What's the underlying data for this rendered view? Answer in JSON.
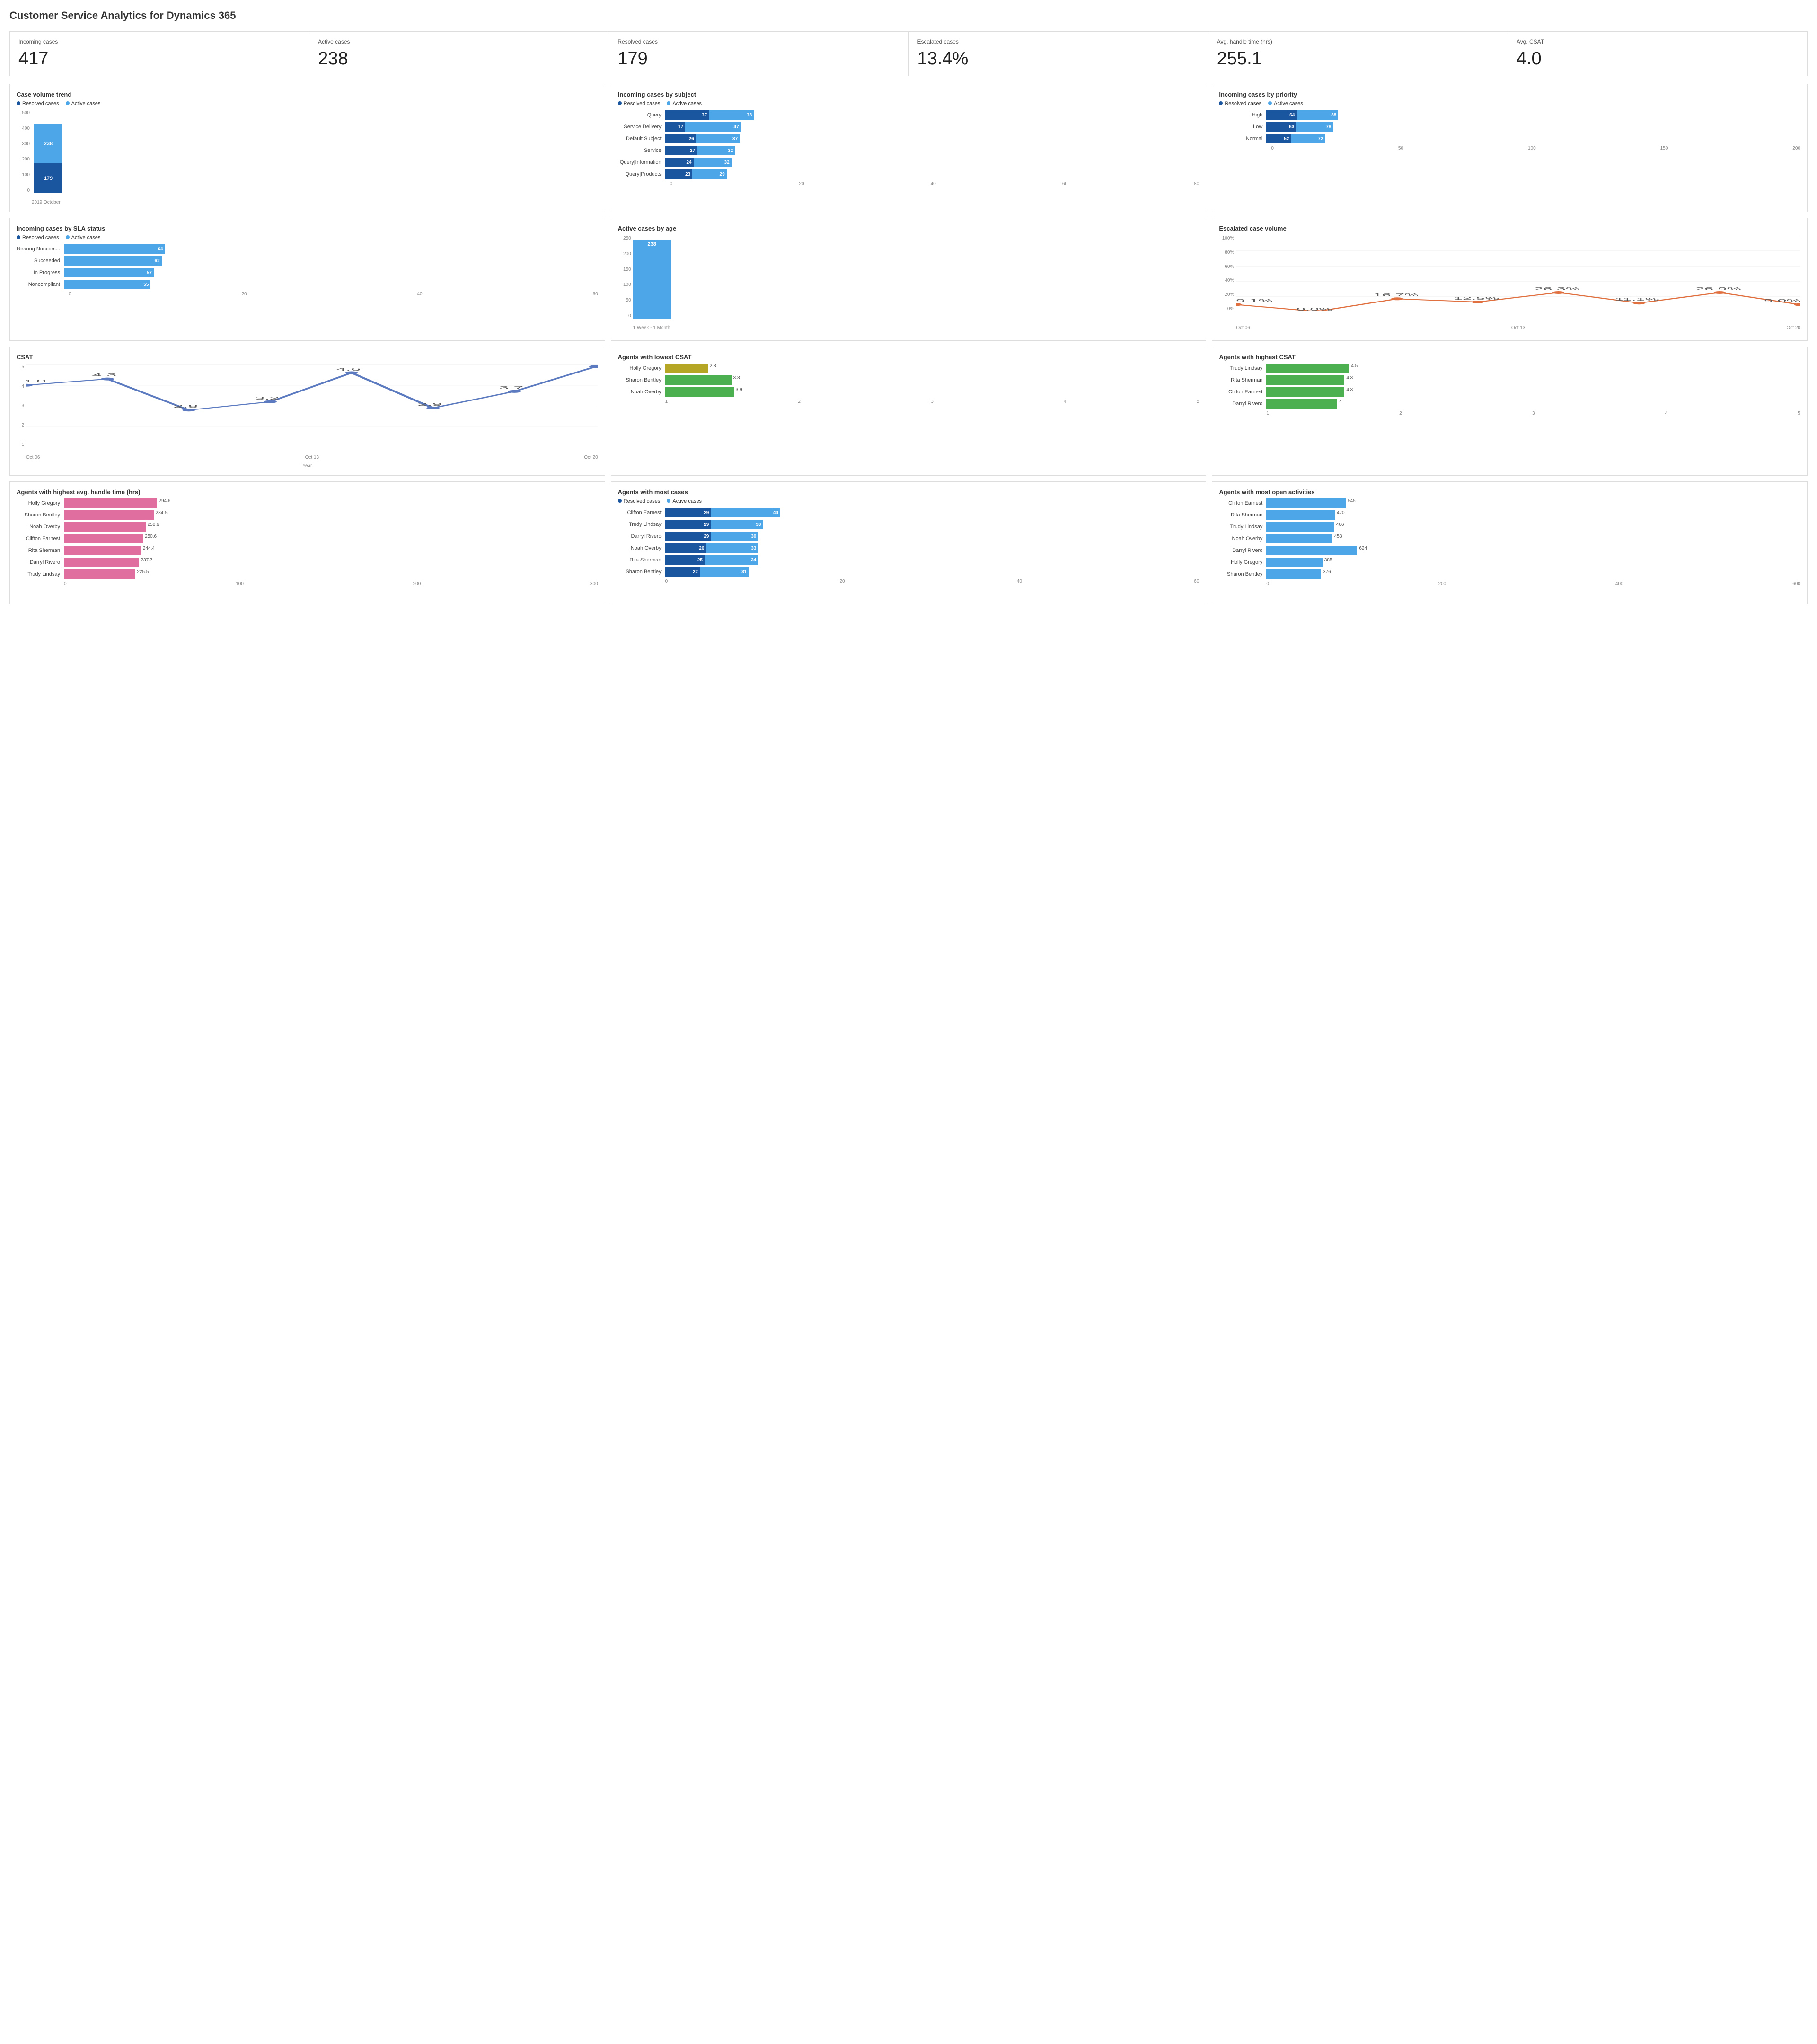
{
  "title": "Customer Service Analytics for Dynamics 365",
  "kpis": [
    {
      "label": "Incoming cases",
      "value": "417"
    },
    {
      "label": "Active cases",
      "value": "238"
    },
    {
      "label": "Resolved cases",
      "value": "179"
    },
    {
      "label": "Escalated cases",
      "value": "13.4%"
    },
    {
      "label": "Avg. handle time (hrs)",
      "value": "255.1"
    },
    {
      "label": "Avg. CSAT",
      "value": "4.0"
    }
  ],
  "caseVolumeTrend": {
    "title": "Case volume trend",
    "legend": [
      "Resolved cases",
      "Active cases"
    ],
    "yLabels": [
      "500",
      "400",
      "300",
      "200",
      "100",
      "0"
    ],
    "bar": {
      "label": "2019 October",
      "resolved": 179,
      "active": 238,
      "totalHeight": 320
    }
  },
  "incomingBySubject": {
    "title": "Incoming cases by subject",
    "legend": [
      "Resolved cases",
      "Active cases"
    ],
    "maxVal": 80,
    "xTicks": [
      "0",
      "20",
      "40",
      "60",
      "80"
    ],
    "rows": [
      {
        "label": "Query",
        "resolved": 37,
        "active": 38
      },
      {
        "label": "Service|Delivery",
        "resolved": 17,
        "active": 47
      },
      {
        "label": "Default Subject",
        "resolved": 26,
        "active": 37
      },
      {
        "label": "Service",
        "resolved": 27,
        "active": 32
      },
      {
        "label": "Query|Information",
        "resolved": 24,
        "active": 32
      },
      {
        "label": "Query|Products",
        "resolved": 23,
        "active": 29
      }
    ]
  },
  "incomingByPriority": {
    "title": "Incoming cases by priority",
    "legend": [
      "Resolved cases",
      "Active cases"
    ],
    "maxVal": 200,
    "xTicks": [
      "0",
      "50",
      "100",
      "150",
      "200"
    ],
    "rows": [
      {
        "label": "High",
        "resolved": 64,
        "active": 88
      },
      {
        "label": "Low",
        "resolved": 63,
        "active": 78
      },
      {
        "label": "Normal",
        "resolved": 52,
        "active": 72
      }
    ]
  },
  "bySLA": {
    "title": "Incoming cases by SLA status",
    "legend": [
      "Resolved cases",
      "Active cases"
    ],
    "maxVal": 60,
    "xTicks": [
      "0",
      "20",
      "40",
      "60"
    ],
    "rows": [
      {
        "label": "Nearing Noncom...",
        "resolved": 0,
        "active": 64
      },
      {
        "label": "Succeeded",
        "resolved": 0,
        "active": 62
      },
      {
        "label": "In Progress",
        "resolved": 0,
        "active": 57
      },
      {
        "label": "Noncompliant",
        "resolved": 0,
        "active": 55
      }
    ]
  },
  "activeByAge": {
    "title": "Active cases by age",
    "yLabels": [
      "250",
      "200",
      "150",
      "100",
      "50",
      "0"
    ],
    "bar": {
      "label": "1 Week - 1 Month",
      "value": 238
    }
  },
  "escalatedVolume": {
    "title": "Escalated case volume",
    "yLabels": [
      "100%",
      "80%",
      "60%",
      "40%",
      "20%",
      "0%"
    ],
    "points": [
      {
        "x": 0,
        "y": 9.1,
        "label": "9.1%"
      },
      {
        "x": 1,
        "y": 0.0,
        "label": "0.0%"
      },
      {
        "x": 2,
        "y": 16.7,
        "label": "16.7%"
      },
      {
        "x": 3,
        "y": 12.5,
        "label": "12.5%"
      },
      {
        "x": 4,
        "y": 26.3,
        "label": "26.3%"
      },
      {
        "x": 5,
        "y": 11.1,
        "label": "11.1%"
      },
      {
        "x": 6,
        "y": 26.9,
        "label": "26.9%"
      },
      {
        "x": 7,
        "y": 9.0,
        "label": "9.0%"
      }
    ],
    "xLabels": [
      "Oct 06",
      "Oct 13",
      "Oct 20"
    ]
  },
  "csat": {
    "title": "CSAT",
    "xAxisLabel": "Year",
    "xLabels": [
      "Oct 06",
      "Oct 13",
      "Oct 20"
    ],
    "points": [
      {
        "x": 0,
        "y": 4.0,
        "label": "4.0"
      },
      {
        "x": 1,
        "y": 4.3,
        "label": "4.3"
      },
      {
        "x": 2,
        "y": 2.8,
        "label": "2.8"
      },
      {
        "x": 3,
        "y": 3.2,
        "label": "3.2"
      },
      {
        "x": 4,
        "y": 4.6,
        "label": "4.6"
      },
      {
        "x": 5,
        "y": 2.9,
        "label": "2.9"
      },
      {
        "x": 6,
        "y": 3.7,
        "label": "3.7"
      },
      {
        "x": 7,
        "y": 4.9,
        "label": "4.9"
      }
    ]
  },
  "agentsLowestCSAT": {
    "title": "Agents with lowest CSAT",
    "maxVal": 5,
    "xTicks": [
      "1",
      "2",
      "3",
      "4",
      "5"
    ],
    "rows": [
      {
        "label": "Holly Gregory",
        "value": 2.8,
        "color": "yellow"
      },
      {
        "label": "Sharon Bentley",
        "value": 3.8,
        "color": "green"
      },
      {
        "label": "Noah Overby",
        "value": 3.9,
        "color": "green"
      }
    ]
  },
  "agentsHighestCSAT": {
    "title": "Agents with highest CSAT",
    "maxVal": 5,
    "xTicks": [
      "1",
      "2",
      "3",
      "4",
      "5"
    ],
    "rows": [
      {
        "label": "Trudy Lindsay",
        "value": 4.5
      },
      {
        "label": "Rita Sherman",
        "value": 4.3
      },
      {
        "label": "Clifton Earnest",
        "value": 4.3
      },
      {
        "label": "Darryl Rivero",
        "value": 4.0
      }
    ]
  },
  "agentsHandleTime": {
    "title": "Agents with highest avg. handle time (hrs)",
    "maxVal": 300,
    "xTicks": [
      "0",
      "100",
      "200",
      "300"
    ],
    "rows": [
      {
        "label": "Holly Gregory",
        "value": 294.6
      },
      {
        "label": "Sharon Bentley",
        "value": 284.5
      },
      {
        "label": "Noah Overby",
        "value": 258.9
      },
      {
        "label": "Clifton Earnest",
        "value": 250.6
      },
      {
        "label": "Rita Sherman",
        "value": 244.4
      },
      {
        "label": "Darryl Rivero",
        "value": 237.7
      },
      {
        "label": "Trudy Lindsay",
        "value": 225.5
      }
    ]
  },
  "agentsMostCases": {
    "title": "Agents with most cases",
    "legend": [
      "Resolved cases",
      "Active cases"
    ],
    "maxVal": 60,
    "xTicks": [
      "0",
      "20",
      "40",
      "60"
    ],
    "rows": [
      {
        "label": "Clifton Earnest",
        "resolved": 29,
        "active": 44
      },
      {
        "label": "Trudy Lindsay",
        "resolved": 29,
        "active": 33
      },
      {
        "label": "Darryl Rivero",
        "resolved": 29,
        "active": 30
      },
      {
        "label": "Noah Overby",
        "resolved": 26,
        "active": 33
      },
      {
        "label": "Rita Sherman",
        "resolved": 25,
        "active": 34
      },
      {
        "label": "Sharon Bentley",
        "resolved": 22,
        "active": 31
      }
    ]
  },
  "agentsOpenActivities": {
    "title": "Agents with most open activities",
    "maxVal": 600,
    "xTicks": [
      "0",
      "200",
      "400",
      "600"
    ],
    "rows": [
      {
        "label": "Clifton Earnest",
        "value": 545
      },
      {
        "label": "Rita Sherman",
        "value": 470
      },
      {
        "label": "Trudy Lindsay",
        "value": 466
      },
      {
        "label": "Noah Overby",
        "value": 453
      },
      {
        "label": "Darryl Rivero",
        "value": 624
      },
      {
        "label": "Holly Gregory",
        "value": 385
      },
      {
        "label": "Sharon Bentley",
        "value": 376
      }
    ]
  },
  "colors": {
    "darkBlue": "#1a56a0",
    "lightBlue": "#4da6e8",
    "green": "#4caf50",
    "yellow": "#b5a625",
    "pink": "#e06fa0",
    "lineBlue": "#5c7abf"
  }
}
